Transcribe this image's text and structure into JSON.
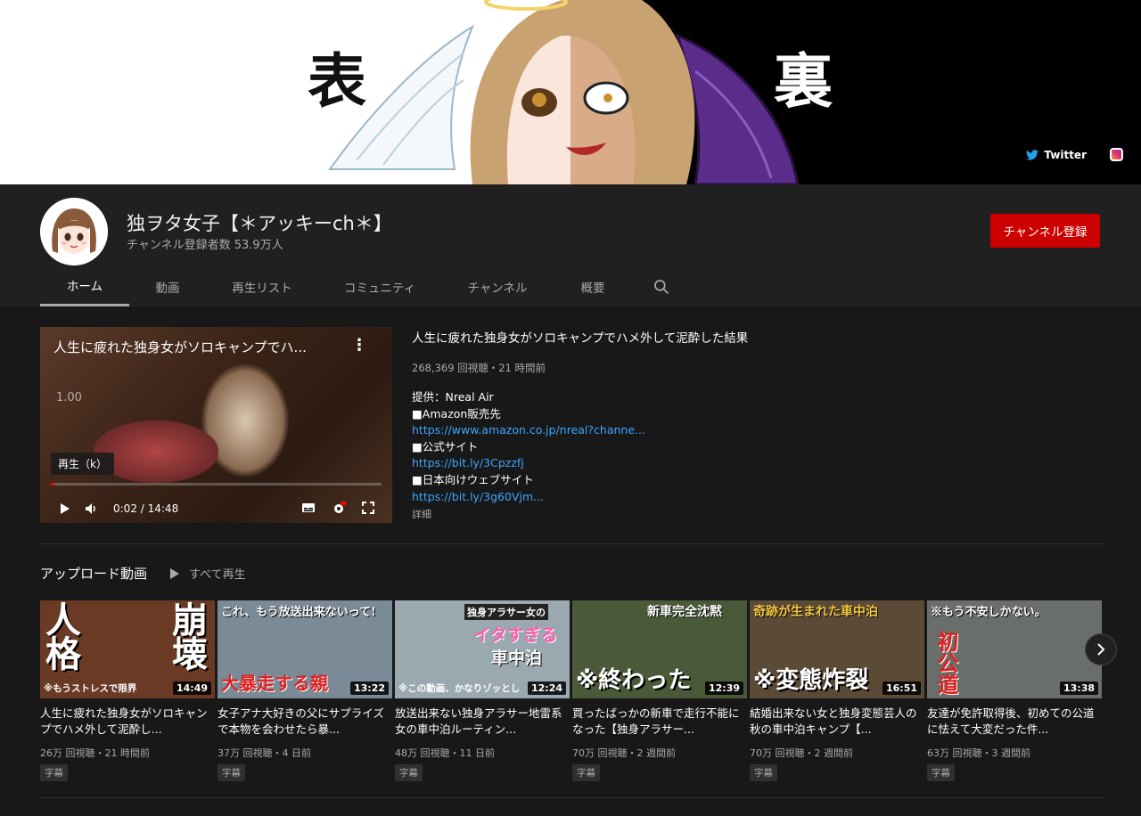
{
  "banner": {
    "kanji_left": "表",
    "kanji_right": "裏",
    "twitter_label": "Twitter"
  },
  "channel": {
    "name": "独ヲタ女子【＊アッキーch＊】",
    "subscribers": "チャンネル登録者数 53.9万人",
    "subscribe_label": "チャンネル登録"
  },
  "tabs": [
    {
      "label": "ホーム",
      "active": true
    },
    {
      "label": "動画"
    },
    {
      "label": "再生リスト"
    },
    {
      "label": "コミュニティ"
    },
    {
      "label": "チャンネル"
    },
    {
      "label": "概要"
    }
  ],
  "featured": {
    "overlay_title": "人生に疲れた独身女がソロキャンプでハ...",
    "speed": "1.00",
    "tooltip": "再生（k）",
    "time": "0:02 / 14:48",
    "progress": 0.002,
    "title": "人生に疲れた独身女がソロキャンプでハメ外して泥酔した結果",
    "meta": "268,369 回視聴・21 時間前",
    "desc": [
      {
        "text": "提供：Nreal Air",
        "link": false
      },
      {
        "text": "■Amazon販売先",
        "link": false
      },
      {
        "text": "https://www.amazon.co.jp/nreal?channe...",
        "link": true
      },
      {
        "text": "■公式サイト",
        "link": false
      },
      {
        "text": "https://bit.ly/3Cpzzfj",
        "link": true
      },
      {
        "text": "■日本向けウェブサイト",
        "link": false
      },
      {
        "text": "https://bit.ly/3g60Vjm...",
        "link": true
      }
    ],
    "more": "詳細"
  },
  "shelf": {
    "title": "アップロード動画",
    "play_all": "すべて再生"
  },
  "videos": [
    {
      "title": "人生に疲れた独身女がソロキャンプでハメ外して泥酔し...",
      "meta": "26万 回視聴・21 時間前",
      "duration": "14:49",
      "badge": "字幕",
      "caption": "※もうストレスで限界",
      "big_left": "人格",
      "big_right": "崩壊",
      "bg": "#6a3a25"
    },
    {
      "title": "女子アナ大好きの父にサプライズで本物を会わせたら暴...",
      "meta": "37万 回視聴・4 日前",
      "duration": "13:22",
      "badge": "字幕",
      "caption": "大暴走する親",
      "top": "これ、もう放送出来ないって!",
      "bg": "#7a8a96"
    },
    {
      "title": "放送出来ない独身アラサー地雷系女の車中泊ルーティン...",
      "meta": "48万 回視聴・11 日前",
      "duration": "12:24",
      "badge": "字幕",
      "caption": "※この動画、かなりゾッとし",
      "top": "独身アラサー女の",
      "mid": "イタすぎる",
      "mid2": "車中泊",
      "bg": "#9aa9b0"
    },
    {
      "title": "買ったばっかの新車で走行不能になった【独身アラサー...",
      "meta": "70万 回視聴・2 週間前",
      "duration": "12:39",
      "badge": "字幕",
      "caption": "※終わった",
      "top": "新車完全沈黙",
      "bg": "#4a5a38"
    },
    {
      "title": "結婚出来ない女と独身変態芸人の秋の車中泊キャンプ【...",
      "meta": "70万 回視聴・2 週間前",
      "duration": "16:51",
      "badge": "字幕",
      "caption": "※変態炸裂",
      "top": "奇跡が生まれた車中泊",
      "bg": "#5a4a36"
    },
    {
      "title": "友達が免許取得後、初めての公道に怯えて大変だった件...",
      "meta": "63万 回視聴・3 週間前",
      "duration": "13:38",
      "badge": "字幕",
      "caption": "初公道",
      "top": "※もう不安しかない。",
      "bg": "#6a6e6a"
    }
  ]
}
